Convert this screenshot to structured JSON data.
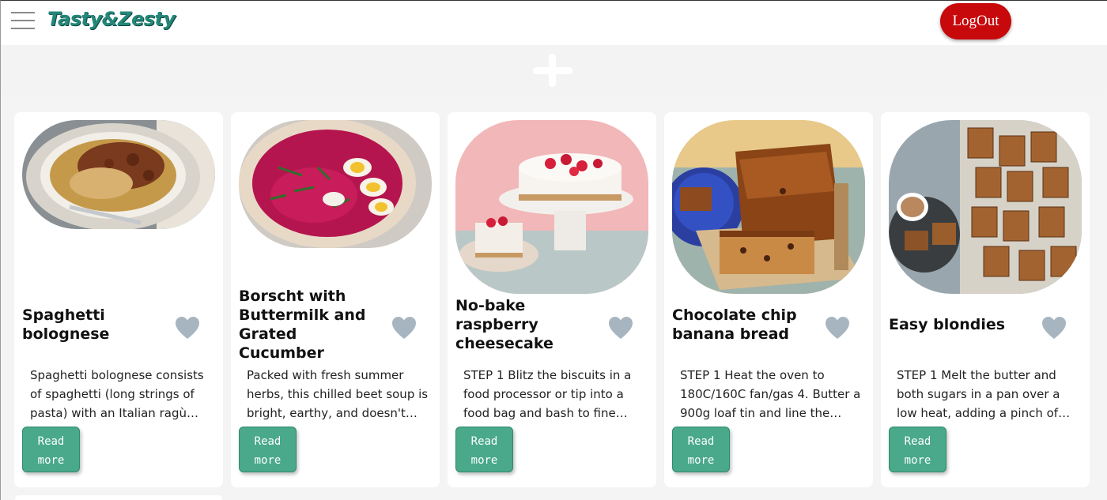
{
  "header": {
    "brand": "Tasty&Zesty",
    "logout_label": "LogOut"
  },
  "recipes": [
    {
      "title": "Spaghetti bolognese",
      "description": "Spaghetti bolognese consists of spaghetti (long strings of pasta) with an Italian ragù (meat…",
      "read_more": "Read more"
    },
    {
      "title": "Borscht with Buttermilk and Grated Cucumber",
      "description": "Packed with fresh summer herbs, this chilled beet soup is bright, earthy, and doesn't…",
      "read_more": "Read more"
    },
    {
      "title": "No-bake raspberry cheesecake",
      "description": "STEP 1 Blitz the biscuits in a food processor or tip into a food bag and bash to fine…",
      "read_more": "Read more"
    },
    {
      "title": "Chocolate chip banana bread",
      "description": "STEP 1 Heat the oven to 180C/160C fan/gas 4. Butter a 900g loaf tin and line the base…",
      "read_more": "Read more"
    },
    {
      "title": "Easy blondies",
      "description": "STEP 1 Melt the butter and both sugars in a pan over a low heat, adding a pinch of salt if the…",
      "read_more": "Read more"
    }
  ],
  "colors": {
    "brand": "#24877a",
    "logout": "#c8090c",
    "read_more": "#49a98a",
    "heart": "#a7b5c0"
  },
  "icons": {
    "menu": "hamburger-icon",
    "add": "plus-icon",
    "favorite": "heart-icon"
  }
}
